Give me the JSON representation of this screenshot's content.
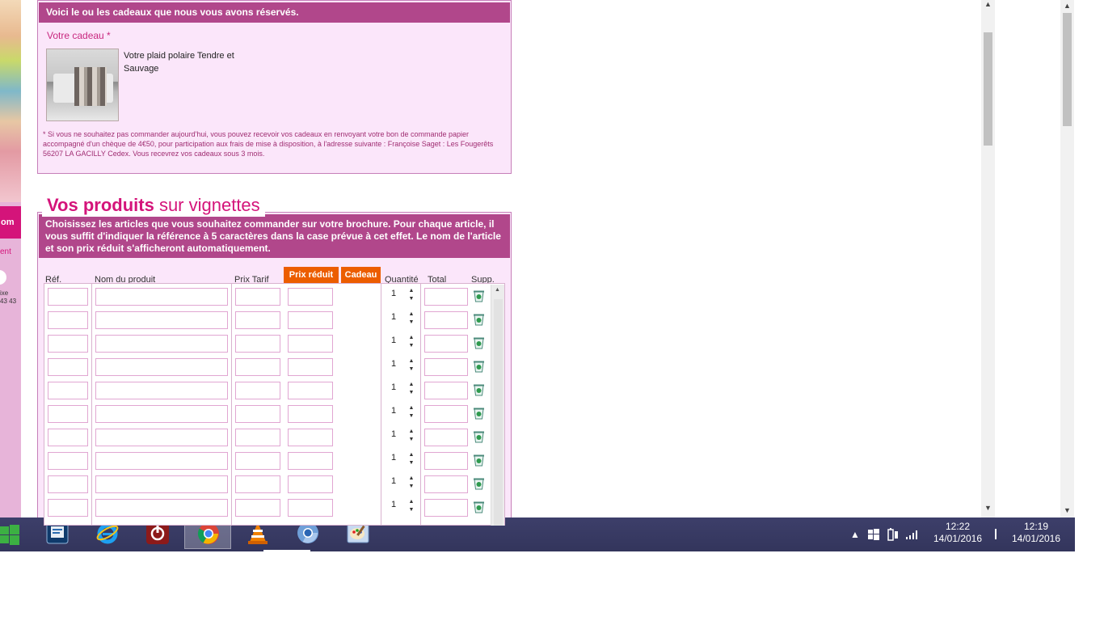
{
  "left_strip": {
    "banner_text": "om",
    "text1": "ent",
    "text2_line1": "ixe",
    "text2_line2": "43 43"
  },
  "gift": {
    "header": "Voici le ou les cadeaux que nous vous avons réservés.",
    "label": "Votre cadeau *",
    "name": "Votre plaid polaire Tendre et Sauvage",
    "note": "* Si vous ne souhaitez pas commander aujourd'hui, vous pouvez recevoir vos cadeaux en renvoyant votre bon de commande papier accompagné d'un chèque de 4€50, pour participation aux frais de mise à disposition, à l'adresse suivante : Françoise Saget : Les Fougerêts 56207 LA GACILLY Cedex. Vous recevrez vos cadeaux sous 3 mois."
  },
  "products": {
    "title_bold": "Vos produits",
    "title_rest": " sur vignettes",
    "instructions": "Choisissez les articles que vous souhaitez commander sur votre brochure. Pour chaque article, il vous suffit d'indiquer la référence à 5 caractères dans la case prévue à cet effet. Le nom de l'article et son prix réduit s'afficheront automatiquement.",
    "columns": {
      "ref": "Réf.",
      "name": "Nom du produit",
      "price": "Prix Tarif",
      "reduced": "Prix réduit",
      "gift": "Cadeau",
      "qty": "Quantité",
      "total": "Total",
      "remove": "Supp."
    },
    "rows": [
      {
        "qty": "1"
      },
      {
        "qty": "1"
      },
      {
        "qty": "1"
      },
      {
        "qty": "1"
      },
      {
        "qty": "1"
      },
      {
        "qty": "1"
      },
      {
        "qty": "1"
      },
      {
        "qty": "1"
      },
      {
        "qty": "1"
      },
      {
        "qty": "1"
      }
    ],
    "accent_color": "#b1478b",
    "orange_color": "#ec5d00"
  },
  "taskbar": {
    "apps": [
      {
        "name": "start-button",
        "icon": "windows-logo-icon"
      },
      {
        "name": "remote-desktop",
        "icon": "remote-desktop-icon"
      },
      {
        "name": "internet-explorer",
        "icon": "ie-icon"
      },
      {
        "name": "shutdown-app",
        "icon": "power-icon"
      },
      {
        "name": "chrome",
        "icon": "chrome-icon",
        "active": true
      },
      {
        "name": "vlc",
        "icon": "vlc-icon"
      },
      {
        "name": "chromium",
        "icon": "chromium-icon"
      },
      {
        "name": "paint",
        "icon": "paint-icon"
      }
    ],
    "clock1_time": "12:22",
    "clock1_date": "14/01/2016",
    "clock2_time": "12:19",
    "clock2_date": "14/01/2016"
  }
}
